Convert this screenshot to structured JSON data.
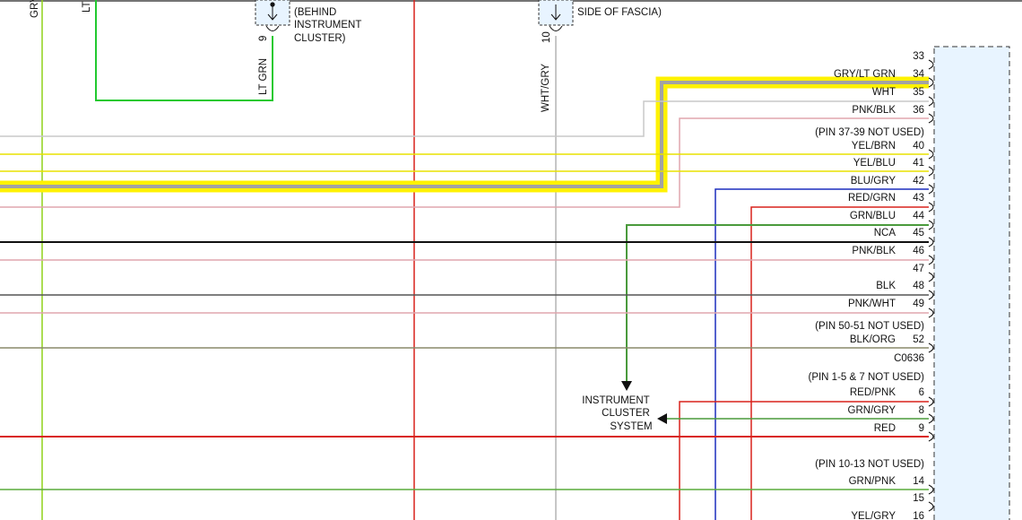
{
  "top_labels": {
    "left_wire_1": "GRY",
    "left_wire_2": "LT",
    "connector_note_1": [
      "(BEHIND",
      "INSTRUMENT",
      "CLUSTER)"
    ],
    "connector_note_2": "SIDE OF FASCIA)",
    "wire_lt_grn": "LT GRN",
    "pin_9": "9",
    "wire_wht_gry": "WHT/GRY",
    "pin_10": "10"
  },
  "destination": {
    "lines": [
      "INSTRUMENT",
      "CLUSTER",
      "SYSTEM"
    ]
  },
  "connector_name": "C0636",
  "pins_upper": [
    {
      "type": "pin",
      "wire": "",
      "num": "33"
    },
    {
      "type": "pin",
      "wire": "GRY/LT GRN",
      "num": "34"
    },
    {
      "type": "pin",
      "wire": "WHT",
      "num": "35"
    },
    {
      "type": "pin",
      "wire": "PNK/BLK",
      "num": "36"
    },
    {
      "type": "note",
      "text": "(PIN 37-39 NOT USED)"
    },
    {
      "type": "pin",
      "wire": "YEL/BRN",
      "num": "40"
    },
    {
      "type": "pin",
      "wire": "YEL/BLU",
      "num": "41"
    },
    {
      "type": "pin",
      "wire": "BLU/GRY",
      "num": "42"
    },
    {
      "type": "pin",
      "wire": "RED/GRN",
      "num": "43"
    },
    {
      "type": "pin",
      "wire": "GRN/BLU",
      "num": "44"
    },
    {
      "type": "pin",
      "wire": "NCA",
      "num": "45"
    },
    {
      "type": "pin",
      "wire": "PNK/BLK",
      "num": "46"
    },
    {
      "type": "pin",
      "wire": "",
      "num": "47"
    },
    {
      "type": "pin",
      "wire": "BLK",
      "num": "48"
    },
    {
      "type": "pin",
      "wire": "PNK/WHT",
      "num": "49"
    },
    {
      "type": "note",
      "text": "(PIN 50-51 NOT USED)"
    },
    {
      "type": "pin",
      "wire": "BLK/ORG",
      "num": "52"
    }
  ],
  "pins_lower": [
    {
      "type": "note",
      "text": "(PIN 1-5 & 7 NOT USED)"
    },
    {
      "type": "pin",
      "wire": "RED/PNK",
      "num": "6"
    },
    {
      "type": "pin",
      "wire": "GRN/GRY",
      "num": "8"
    },
    {
      "type": "pin",
      "wire": "RED",
      "num": "9"
    },
    {
      "type": "note",
      "text": "(PIN 10-13 NOT USED)"
    },
    {
      "type": "pin",
      "wire": "GRN/PNK",
      "num": "14"
    },
    {
      "type": "pin",
      "wire": "",
      "num": "15"
    },
    {
      "type": "pin",
      "wire": "YEL/GRY",
      "num": "16"
    }
  ],
  "colors": {
    "highlight": "#fff200",
    "green": "#22c930",
    "lime": "#8fd21a",
    "red": "#d9221c",
    "gray": "#b3b3b3",
    "yellow": "#e8e200",
    "pink": "#e0a5ad",
    "blue": "#1c2dbd",
    "dkgreen": "#4a9a3c",
    "black": "#111111",
    "olive": "#8a8a6a",
    "connector_fill": "#e8f4ff"
  }
}
